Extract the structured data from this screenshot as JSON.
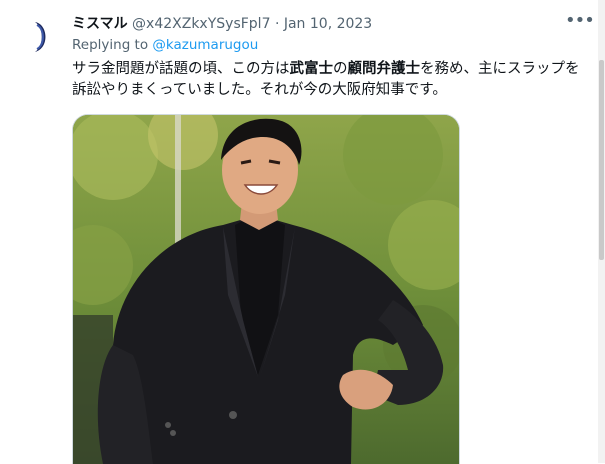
{
  "tweet": {
    "author_name": "ミスマル",
    "handle": "@x42XZkxYSysFpl7",
    "separator": "·",
    "date": "Jan 10, 2023",
    "reply_prefix": "Replying to",
    "reply_mention": "@kazumarugou",
    "text_1": "サラ金問題が話題の頃、この方は",
    "text_bold_1": "武富士",
    "text_2": "の",
    "text_bold_2": "顧問弁護士",
    "text_3": "を務め、主にスラップを訴訟やりまくっていました。それが今の大阪府知事です。",
    "more_icon": "more-horizontal-icon",
    "avatar_icon": "crescent-avatar-icon"
  },
  "colors": {
    "accent": "#1d9bf0",
    "text": "#0f1419",
    "secondary": "#536471"
  }
}
